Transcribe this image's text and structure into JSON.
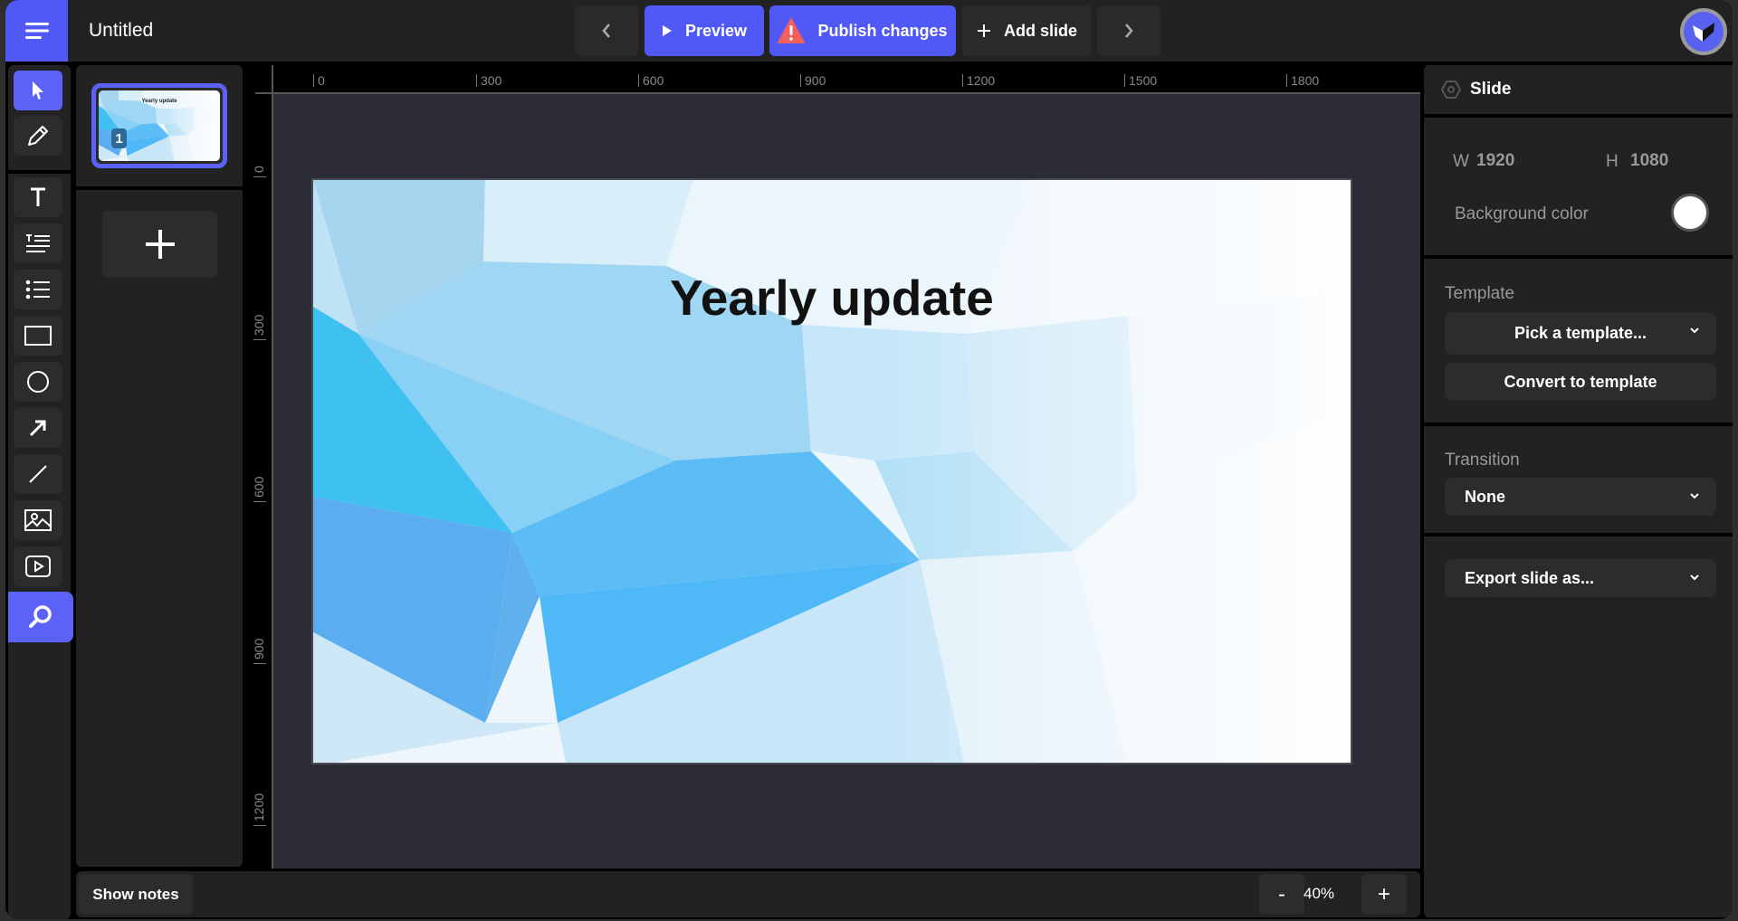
{
  "app": {
    "title": "Untitled",
    "accent_color": "#5058f5",
    "warning_color": "#f25f5c"
  },
  "toolbar": {
    "prev_icon": "chevron-left-icon",
    "preview_label": "Preview",
    "publish_label": "Publish changes",
    "add_slide_label": "Add slide",
    "next_icon": "chevron-right-icon"
  },
  "tools": [
    {
      "name": "select",
      "icon": "cursor-icon",
      "active": true
    },
    {
      "name": "pen",
      "icon": "pencil-icon"
    },
    {
      "name": "text",
      "icon": "text-icon"
    },
    {
      "name": "paragraph",
      "icon": "paragraph-icon"
    },
    {
      "name": "list",
      "icon": "list-icon"
    },
    {
      "name": "rectangle",
      "icon": "rectangle-icon"
    },
    {
      "name": "ellipse",
      "icon": "circle-icon"
    },
    {
      "name": "arrow",
      "icon": "arrow-icon"
    },
    {
      "name": "line",
      "icon": "line-icon"
    },
    {
      "name": "image",
      "icon": "image-icon"
    },
    {
      "name": "video",
      "icon": "video-icon"
    },
    {
      "name": "search",
      "icon": "search-icon"
    }
  ],
  "slides": [
    {
      "number": "1",
      "title": "Yearly update",
      "selected": true
    }
  ],
  "rulers": {
    "horizontal": [
      "0",
      "300",
      "600",
      "900",
      "1200",
      "1500",
      "1800"
    ],
    "vertical": [
      "0",
      "300",
      "600",
      "900",
      "1200"
    ]
  },
  "slide": {
    "title": "Yearly update"
  },
  "bottom": {
    "show_notes_label": "Show notes",
    "zoom_out_label": "-",
    "zoom_value": "40%",
    "zoom_in_label": "+"
  },
  "inspector": {
    "header": "Slide",
    "width_label": "W",
    "width_value": "1920",
    "height_label": "H",
    "height_value": "1080",
    "bg_color_label": "Background color",
    "bg_color": "#ffffff",
    "template_label": "Template",
    "template_select": "Pick a template...",
    "convert_label": "Convert to template",
    "transition_label": "Transition",
    "transition_value": "None",
    "export_label": "Export slide as..."
  }
}
